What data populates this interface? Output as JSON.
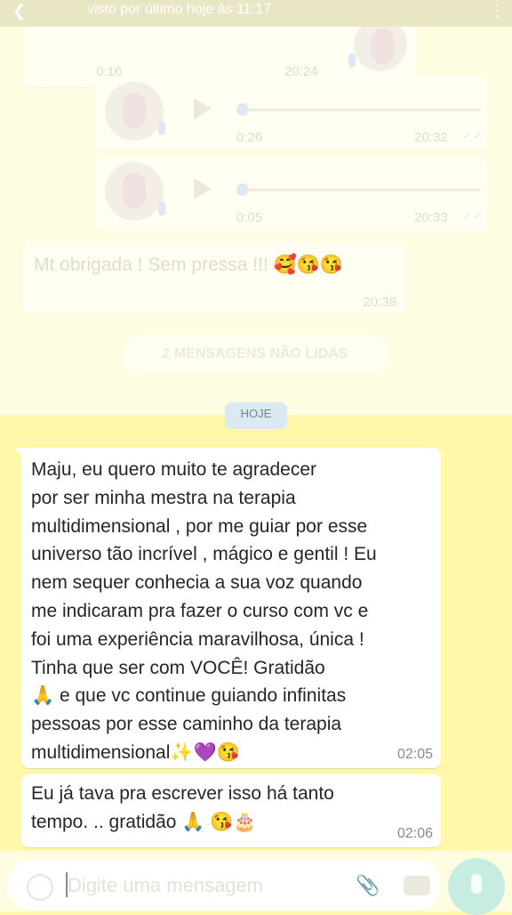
{
  "header": {
    "status": "visto por último hoje às 11:17"
  },
  "faded": {
    "voice_notes": [
      {
        "duration": "0:16",
        "time": "20:24"
      },
      {
        "duration": "0:26",
        "time": "20:32"
      },
      {
        "duration": "0:05",
        "time": "20:33"
      }
    ],
    "text_message": {
      "text": "Mt obrigada ! Sem pressa !!! 🥰😘😘",
      "time": "20:38"
    },
    "unread_banner": "2 MENSAGENS NÃO LIDAS"
  },
  "date_chip": "HOJE",
  "messages": [
    {
      "lines": [
        "Maju, eu quero muito te agradecer",
        "por ser minha mestra na terapia",
        "multidimensional , por me guiar por esse",
        "universo tão incrível , mágico e gentil ! Eu",
        "nem sequer conhecia a sua voz quando",
        "me indicaram pra fazer o curso com vc e",
        "foi uma experiência maravilhosa, única !",
        "Tinha que ser com VOCÊ!  Gratidão",
        "🙏  e que vc continue guiando infinitas",
        "pessoas por esse caminho da terapia",
        "multidimensional✨💜😘"
      ],
      "time": "02:05"
    },
    {
      "lines": [
        "Eu já tava pra escrever isso há tanto",
        "tempo. .. gratidão 🙏 😘🎂"
      ],
      "time": "02:06"
    }
  ],
  "composer": {
    "placeholder": "Digite uma mensagem"
  },
  "colors": {
    "background": "#fff8a8",
    "bubble": "#ffffff",
    "mic_button": "#c7ece1"
  }
}
